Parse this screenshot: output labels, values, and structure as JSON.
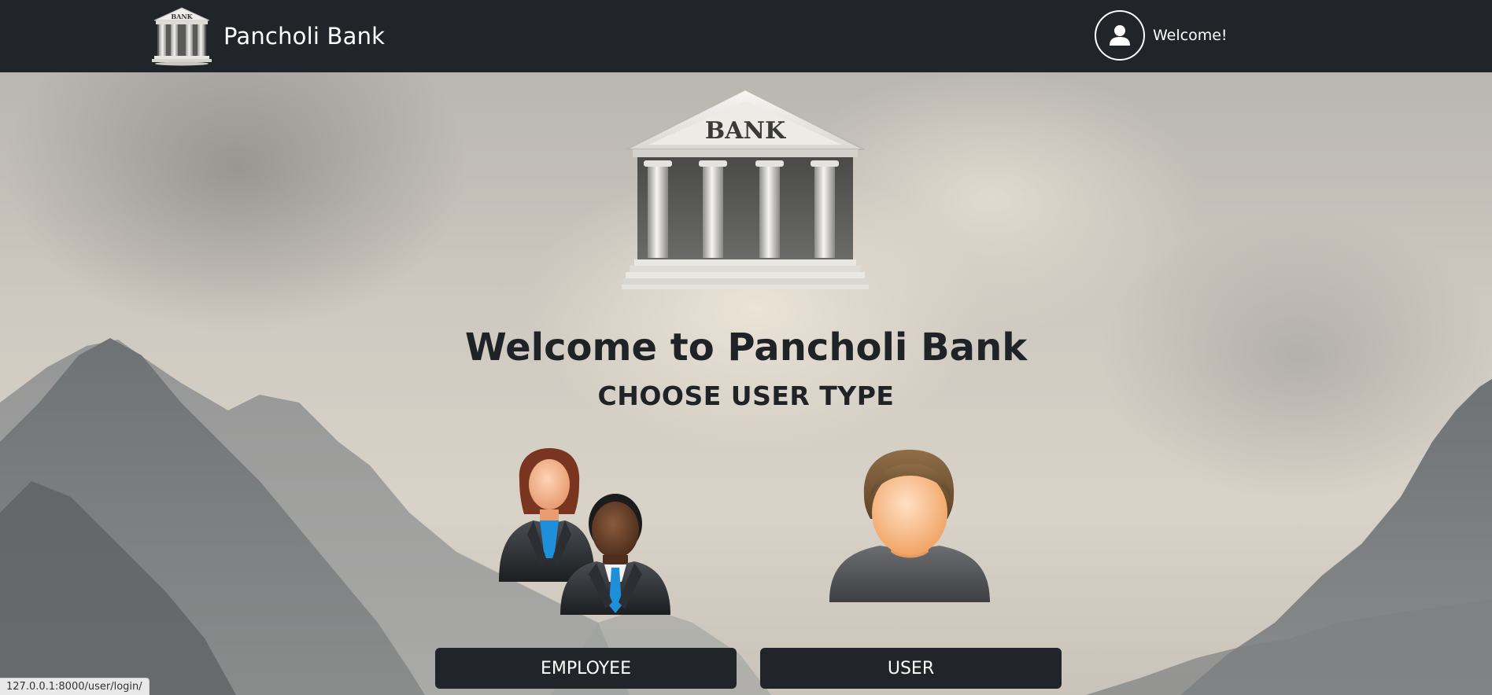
{
  "navbar": {
    "brand_name": "Pancholi Bank",
    "logo_text": "BANK",
    "welcome_text": "Welcome!",
    "avatar_icon": "user-icon"
  },
  "hero": {
    "logo_text": "BANK",
    "title": "Welcome to Pancholi Bank",
    "subtitle": "CHOOSE USER TYPE",
    "employee_image": "employees-icon",
    "user_image": "user-avatar-icon"
  },
  "buttons": {
    "employee": "EMPLOYEE",
    "user": "USER"
  },
  "status_bar": {
    "url": "127.0.0.1:8000/user/login/"
  },
  "colors": {
    "navbar_bg": "#212529",
    "button_bg": "#212529",
    "button_text": "#ffffff",
    "title_text": "#1f2226"
  }
}
